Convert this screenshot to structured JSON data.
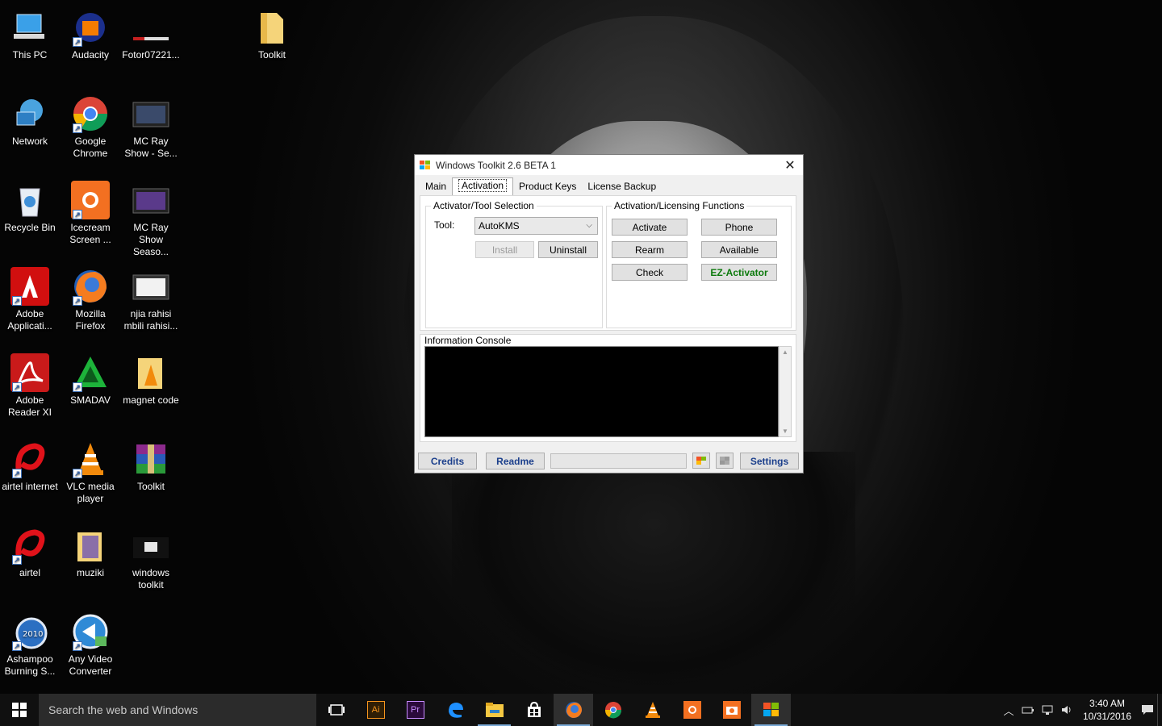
{
  "desktop": {
    "icons": [
      {
        "label": "This PC"
      },
      {
        "label": "Audacity"
      },
      {
        "label": "Fotor07221..."
      },
      {
        "label": "Toolkit"
      },
      {
        "label": "Network"
      },
      {
        "label": "Google Chrome"
      },
      {
        "label": "MC Ray Show - Se..."
      },
      {
        "label": "Recycle Bin"
      },
      {
        "label": "Icecream Screen ..."
      },
      {
        "label": "MC Ray Show Seaso..."
      },
      {
        "label": "Adobe Applicati..."
      },
      {
        "label": "Mozilla Firefox"
      },
      {
        "label": "njia rahisi mbili rahisi..."
      },
      {
        "label": "Adobe Reader XI"
      },
      {
        "label": "SMADAV"
      },
      {
        "label": "magnet code"
      },
      {
        "label": "airtel internet"
      },
      {
        "label": "VLC media player"
      },
      {
        "label": "Toolkit"
      },
      {
        "label": "airtel"
      },
      {
        "label": "muziki"
      },
      {
        "label": "windows toolkit"
      },
      {
        "label": "Ashampoo Burning S..."
      },
      {
        "label": "Any Video Converter"
      }
    ]
  },
  "window": {
    "title": "Windows Toolkit 2.6 BETA 1",
    "close": "✕",
    "tabs": [
      "Main",
      "Activation",
      "Product Keys",
      "License Backup"
    ],
    "activator_group": {
      "title": "Activator/Tool Selection",
      "tool_label": "Tool:",
      "tool_value": "AutoKMS",
      "install": "Install",
      "uninstall": "Uninstall"
    },
    "licensing_group": {
      "title": "Activation/Licensing Functions",
      "activate": "Activate",
      "phone": "Phone",
      "rearm": "Rearm",
      "available": "Available",
      "check": "Check",
      "ez": "EZ-Activator"
    },
    "console_title": "Information Console",
    "bottom": {
      "credits": "Credits",
      "readme": "Readme",
      "settings": "Settings"
    }
  },
  "taskbar": {
    "search_placeholder": "Search the web and Windows",
    "time": "3:40 AM",
    "date": "10/31/2016",
    "ai_label": "Ai",
    "pr_label": "Pr"
  }
}
